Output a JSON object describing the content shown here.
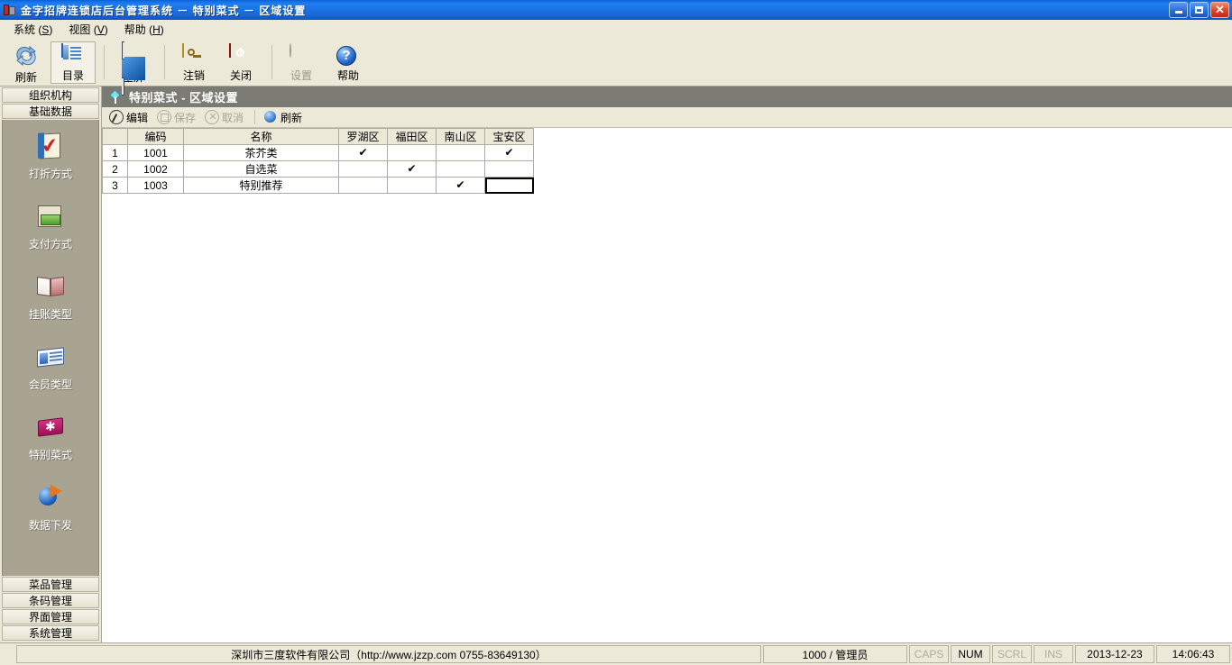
{
  "window": {
    "title": "金字招牌连锁店后台管理系统  －  特别菜式  －  区域设置",
    "icon": "app-icon",
    "controls": {
      "minimize": "最小化",
      "maximize": "还原",
      "close": "关闭"
    }
  },
  "menubar": {
    "items": [
      {
        "label": "系统",
        "accel": "S"
      },
      {
        "label": "视图",
        "accel": "V"
      },
      {
        "label": "帮助",
        "accel": "H"
      }
    ]
  },
  "toolbar": {
    "buttons": [
      {
        "label": "刷新",
        "icon": "refresh-icon",
        "enabled": true,
        "active": false
      },
      {
        "label": "目录",
        "icon": "list-icon",
        "enabled": true,
        "active": true
      },
      {
        "label": "全屏",
        "icon": "fullscreen-icon",
        "enabled": true,
        "active": false
      },
      {
        "label": "注销",
        "icon": "key-icon",
        "enabled": true,
        "active": false
      },
      {
        "label": "关闭",
        "icon": "power-icon",
        "enabled": true,
        "active": false
      },
      {
        "label": "设置",
        "icon": "globe-gear-icon",
        "enabled": false,
        "active": false
      },
      {
        "label": "帮助",
        "icon": "help-icon",
        "enabled": true,
        "active": false
      }
    ]
  },
  "sidebar": {
    "top_buttons": [
      {
        "label": "组织机构"
      },
      {
        "label": "基础数据"
      }
    ],
    "items": [
      {
        "label": "打折方式",
        "icon": "discount-clipboard-icon"
      },
      {
        "label": "支付方式",
        "icon": "payment-money-icon"
      },
      {
        "label": "挂账类型",
        "icon": "credit-book-icon"
      },
      {
        "label": "会员类型",
        "icon": "member-card-icon"
      },
      {
        "label": "特别菜式",
        "icon": "special-dish-icon"
      },
      {
        "label": "数据下发",
        "icon": "data-send-icon"
      }
    ],
    "bottom_buttons": [
      {
        "label": "菜品管理"
      },
      {
        "label": "条码管理"
      },
      {
        "label": "界面管理"
      },
      {
        "label": "系统管理"
      }
    ]
  },
  "page": {
    "header_icon": "diamond-pin-icon",
    "header_title": "特别菜式 - 区域设置",
    "actions": [
      {
        "label": "编辑",
        "icon": "edit-pen-icon",
        "enabled": true
      },
      {
        "label": "保存",
        "icon": "save-disk-icon",
        "enabled": false
      },
      {
        "label": "取消",
        "icon": "cancel-x-icon",
        "enabled": false
      },
      {
        "label": "刷新",
        "icon": "refresh-icon",
        "enabled": true
      }
    ]
  },
  "grid": {
    "columns": [
      "",
      "编码",
      "名称",
      "罗湖区",
      "福田区",
      "南山区",
      "宝安区"
    ],
    "check_glyph": "✔",
    "rows": [
      {
        "no": "1",
        "code": "1001",
        "name": "茶芥类",
        "luohu": true,
        "futian": false,
        "nanshan": false,
        "baoan": true
      },
      {
        "no": "2",
        "code": "1002",
        "name": "自选菜",
        "luohu": false,
        "futian": true,
        "nanshan": false,
        "baoan": false
      },
      {
        "no": "3",
        "code": "1003",
        "name": "特别推荐",
        "luohu": false,
        "futian": false,
        "nanshan": true,
        "baoan": false
      }
    ],
    "selected_cell": {
      "row": 3,
      "column": "宝安区"
    }
  },
  "statusbar": {
    "company": "深圳市三度软件有限公司（http://www.jzzp.com  0755-83649130）",
    "user": "1000 / 管理员",
    "flags": [
      {
        "label": "CAPS",
        "on": false
      },
      {
        "label": "NUM",
        "on": true
      },
      {
        "label": "SCRL",
        "on": false
      },
      {
        "label": "INS",
        "on": false
      }
    ],
    "date": "2013-12-23",
    "time": "14:06:43"
  },
  "colors": {
    "titlebar_blue": "#1e7ef0",
    "chrome": "#ece9d8",
    "sidebar_panel": "#a9a492",
    "page_header": "#7b7b73",
    "grid_border": "#b0ac9d"
  }
}
